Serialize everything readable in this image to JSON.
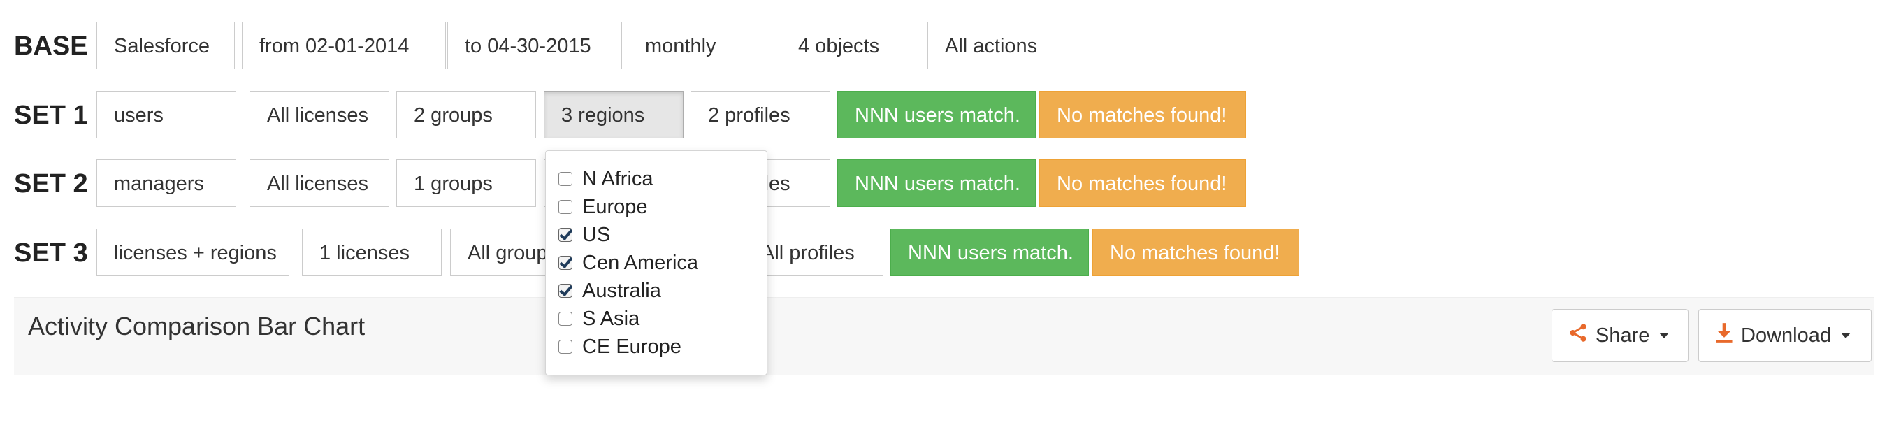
{
  "base": {
    "label": "BASE",
    "items": [
      "Salesforce",
      "from 02-01-2014",
      "to 04-30-2015",
      "monthly",
      "4 objects",
      "All actions"
    ]
  },
  "sets": [
    {
      "label": "SET 1",
      "items": [
        "users",
        "All licenses",
        "2 groups",
        "3 regions",
        "2 profiles"
      ],
      "match": "NNN users match.",
      "status": "No matches found!"
    },
    {
      "label": "SET 2",
      "items": [
        "managers",
        "All licenses",
        "1 groups",
        "",
        "2 profiles"
      ],
      "match": "NNN users match.",
      "status": "No matches found!"
    },
    {
      "label": "SET 3",
      "items": [
        "licenses + regions",
        "1 licenses",
        "All groups",
        "",
        "All profiles"
      ],
      "match": "NNN users match.",
      "status": "No matches found!"
    }
  ],
  "region_dropdown": {
    "options": [
      {
        "label": "N Africa",
        "checked": false
      },
      {
        "label": "Europe",
        "checked": false
      },
      {
        "label": "US",
        "checked": true
      },
      {
        "label": "Cen America",
        "checked": true
      },
      {
        "label": "Australia",
        "checked": true
      },
      {
        "label": "S Asia",
        "checked": false
      },
      {
        "label": "CE Europe",
        "checked": false
      }
    ]
  },
  "chart_panel": {
    "title": "Activity Comparison Bar Chart",
    "share_label": "Share",
    "download_label": "Download"
  },
  "colors": {
    "match_green": "#5cb85c",
    "status_orange": "#f0ad4e",
    "icon_orange": "#e8692b"
  }
}
